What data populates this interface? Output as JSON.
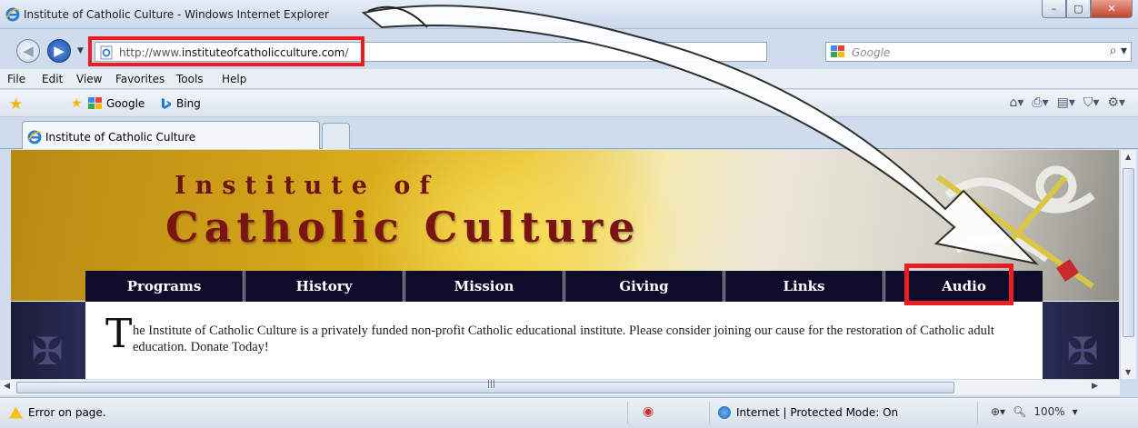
{
  "window": {
    "title": "Institute of Catholic Culture - Windows Internet Explorer",
    "minimize_glyph": "–",
    "maximize_glyph": "▢",
    "close_glyph": "✕"
  },
  "address": {
    "url_prefix": "http://www.",
    "url_domain": "instituteofcatholicculture.com",
    "url_suffix": "/",
    "search_placeholder": "Google"
  },
  "menu": {
    "items": [
      "File",
      "Edit",
      "View",
      "Favorites",
      "Tools",
      "Help"
    ]
  },
  "favorites": {
    "links": [
      "Google",
      "Bing"
    ]
  },
  "tabs": {
    "active_label": "Institute of Catholic Culture"
  },
  "site": {
    "title_line1": "Institute of",
    "title_line2": "Catholic Culture",
    "nav": [
      "Programs",
      "History",
      "Mission",
      "Giving",
      "Links",
      "Audio"
    ],
    "intro_dropcap": "T",
    "intro_text": "he Institute of Catholic Culture is a privately funded non-profit Catholic educational institute. Please consider joining our cause for the restoration of Catholic adult education. Donate Today!"
  },
  "status": {
    "message": "Error on page.",
    "zone": "Internet | Protected Mode: On",
    "zoom": "100%"
  },
  "colors": {
    "highlight": "#ed1c24",
    "site_nav_bg": "#0d0d2b",
    "title_red": "#7a1414"
  },
  "icons": [
    "ie-icon",
    "back-arrow-icon",
    "forward-arrow-icon",
    "page-icon",
    "compat-view-icon",
    "refresh-icon",
    "stop-icon",
    "google-icon",
    "search-icon",
    "favorites-star-icon",
    "add-favorites-icon",
    "bing-icon",
    "home-icon",
    "print-icon",
    "page-menu-icon",
    "safety-icon",
    "tools-gear-icon",
    "warning-icon",
    "privacy-icon",
    "globe-icon",
    "zoom-icon"
  ]
}
